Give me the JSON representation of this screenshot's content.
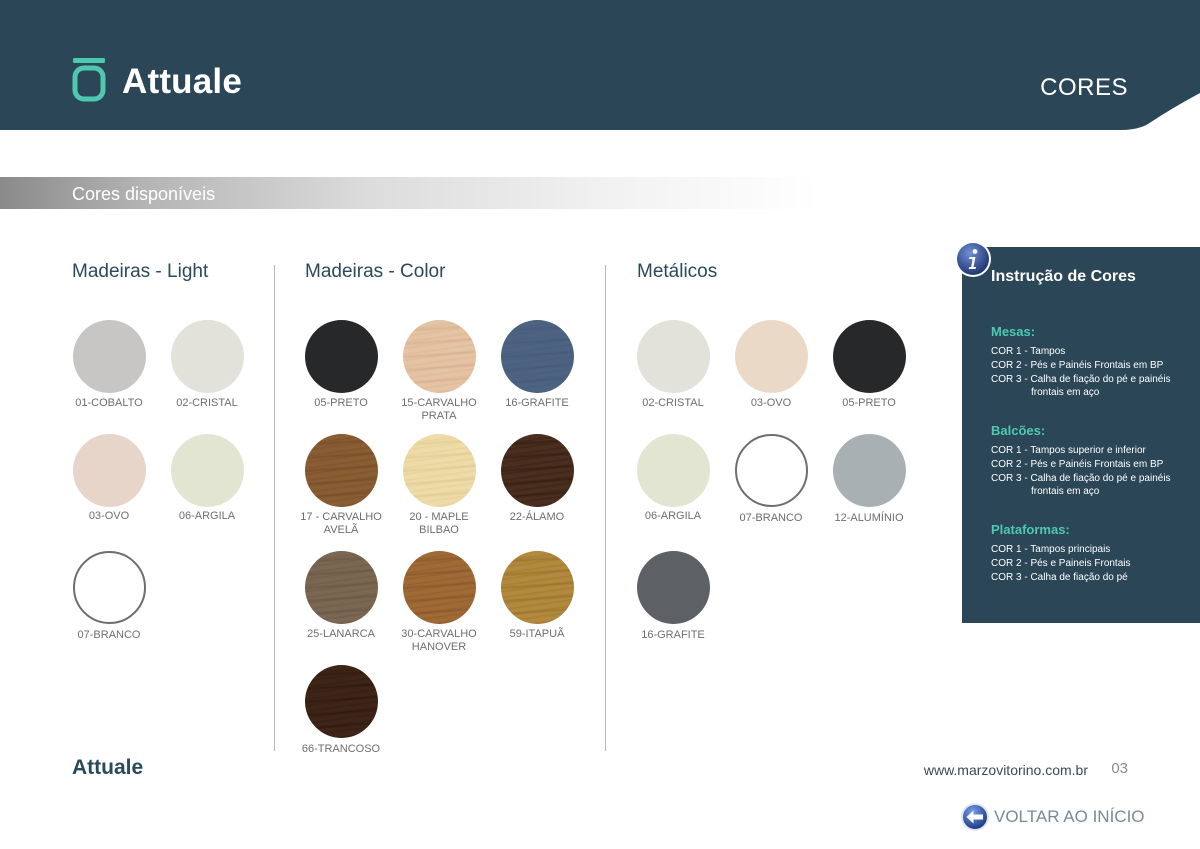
{
  "header": {
    "brand": "Attuale",
    "page_tag": "CORES",
    "bg_color": "#2b4657",
    "accent_color": "#4ec9b0"
  },
  "section": {
    "title": "Cores disponíveis"
  },
  "columns": [
    {
      "title": "Madeiras - Light",
      "swatches": [
        {
          "label": "01-COBALTO",
          "color": "#c7c6c4"
        },
        {
          "label": "02-CRISTAL",
          "color": "#e2e2da"
        },
        {
          "label": "03-OVO",
          "color": "#e6d5c8"
        },
        {
          "label": "06-ARGILA",
          "color": "#e3e5d3"
        },
        {
          "label": "07-BRANCO",
          "color": "#ffffff",
          "outline": true
        }
      ]
    },
    {
      "title": "Madeiras - Color",
      "swatches": [
        {
          "label": "05-PRETO",
          "color": "#27282a"
        },
        {
          "label": "15-CARVALHO\nPRATA",
          "color": "#e4c4a4",
          "grain": "#d3a884"
        },
        {
          "label": "16-GRAFITE",
          "color": "#4d6382",
          "grain": "#435773"
        },
        {
          "label": "17 - CARVALHO\nAVELÃ",
          "color": "#8a5d33",
          "grain": "#6e4624"
        },
        {
          "label": "20 - MAPLE\nBILBAO",
          "color": "#eedba8",
          "grain": "#dcc48c"
        },
        {
          "label": "22-ÁLAMO",
          "color": "#4a2e1e",
          "grain": "#2a170d"
        },
        {
          "label": "25-LANARCA",
          "color": "#7b6752",
          "grain": "#625240"
        },
        {
          "label": "30-CARVALHO\nHANOVER",
          "color": "#a06a36",
          "grain": "#7e4f22"
        },
        {
          "label": "59-ITAPUÃ",
          "color": "#b2893d",
          "grain": "#8f6a26"
        },
        {
          "label": "66-TRANCOSO",
          "color": "#3f2518",
          "grain": "#27140a"
        }
      ]
    },
    {
      "title": "Metálicos",
      "swatches": [
        {
          "label": "02-CRISTAL",
          "color": "#e2e2da"
        },
        {
          "label": "03-OVO",
          "color": "#ead9c7"
        },
        {
          "label": "05-PRETO",
          "color": "#27282a"
        },
        {
          "label": "06-ARGILA",
          "color": "#e3e5d3"
        },
        {
          "label": "07-BRANCO",
          "color": "#ffffff",
          "outline": true
        },
        {
          "label": "12-ALUMÍNIO",
          "color": "#a8b0b4"
        },
        {
          "label": "16-GRAFITE",
          "color": "#5d6064"
        }
      ]
    }
  ],
  "instructions": {
    "title": "Instrução de Cores",
    "icon": "info-icon",
    "groups": [
      {
        "heading": "Mesas:",
        "lines": [
          "COR 1 - Tampos",
          "COR 2 - Pés e Painéis Frontais em BP",
          "COR 3 - Calha de fiação do pé e painéis frontais em aço"
        ]
      },
      {
        "heading": "Balcões:",
        "lines": [
          "COR 1 - Tampos superior e inferior",
          "COR 2 - Pés e Painéis Frontais em BP",
          "COR 3 - Calha de fiação do pé e painéis frontais em aço"
        ]
      },
      {
        "heading": "Plataformas:",
        "lines": [
          "COR 1 - Tampos principais",
          "COR 2 - Pés e Paineis Frontais",
          "COR 3 - Calha de fiação do pé"
        ]
      }
    ]
  },
  "footer": {
    "brand": "Attuale",
    "url": "www.marzovitorino.com.br",
    "page_number": "03",
    "back_label": "VOLTAR AO INÍCIO",
    "back_icon": "arrow-left-icon"
  }
}
